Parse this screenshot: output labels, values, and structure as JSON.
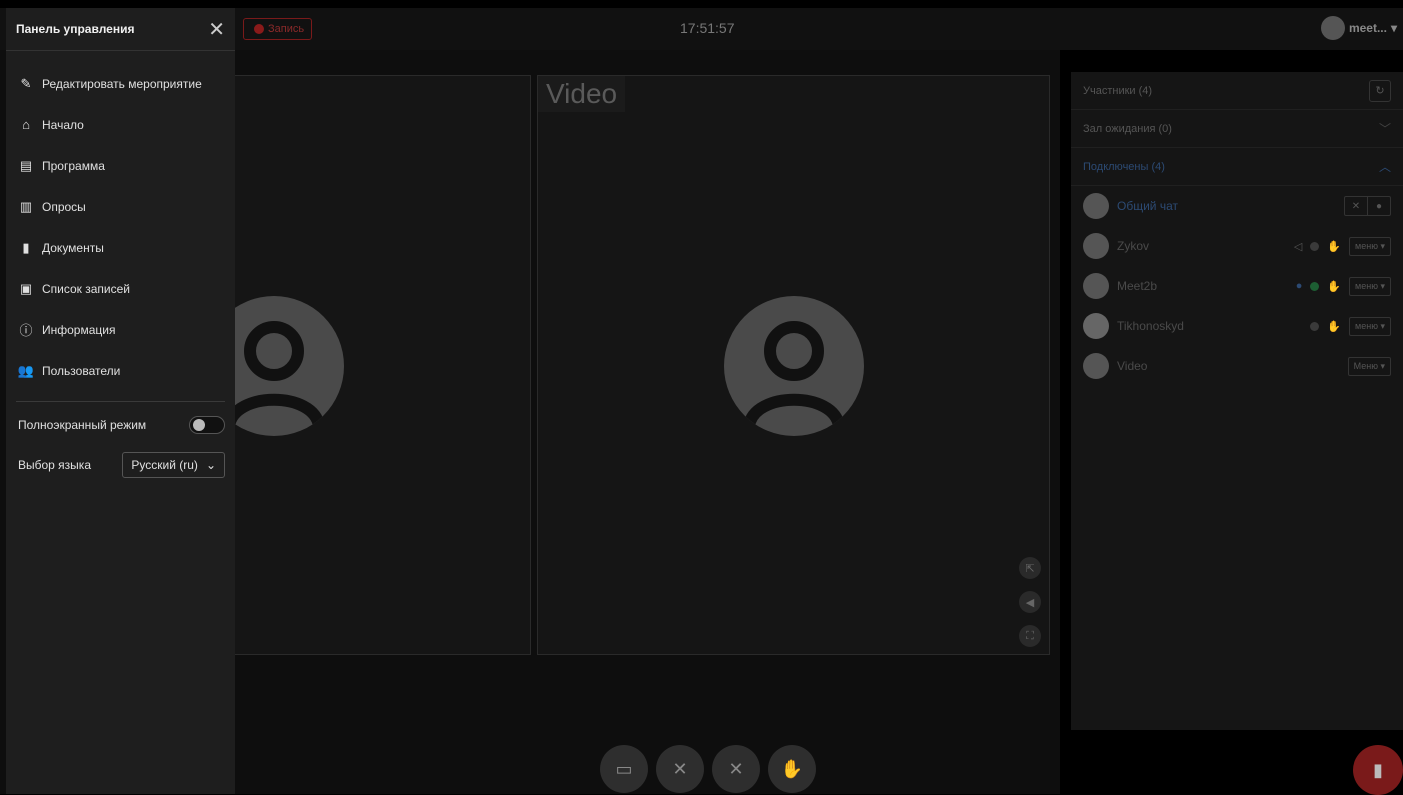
{
  "topbar": {
    "record_label": "Запись",
    "clock": "17:51:57",
    "user_name": "meet..."
  },
  "sidebar": {
    "title": "Панель управления",
    "items": [
      {
        "label": "Редактировать мероприятие",
        "icon": "edit-icon"
      },
      {
        "label": "Начало",
        "icon": "home-icon"
      },
      {
        "label": "Программа",
        "icon": "program-icon"
      },
      {
        "label": "Опросы",
        "icon": "poll-icon"
      },
      {
        "label": "Документы",
        "icon": "document-icon"
      },
      {
        "label": "Список записей",
        "icon": "recordings-icon"
      },
      {
        "label": "Информация",
        "icon": "info-icon"
      },
      {
        "label": "Пользователи",
        "icon": "users-icon"
      }
    ],
    "fullscreen_label": "Полноэкранный режим",
    "fullscreen_on": false,
    "language_label": "Выбор языка",
    "language_value": "Русский (ru)"
  },
  "stage": {
    "tile2_label": "Video"
  },
  "participants": {
    "header": "Участники  (4)",
    "waiting": "Зал ожидания (0)",
    "connected": "Подключены (4)",
    "chat": "Общий чат",
    "people": [
      {
        "name": "Zykov",
        "menu": "меню"
      },
      {
        "name": "Meet2b",
        "menu": "меню"
      },
      {
        "name": "Tikhonoskyd",
        "menu": "меню"
      },
      {
        "name": "Video",
        "menu": "Меню"
      }
    ]
  },
  "colors": {
    "accent_blue": "#2c4a73",
    "record_red": "#7a1a1a",
    "online_green": "#1d5e33"
  }
}
